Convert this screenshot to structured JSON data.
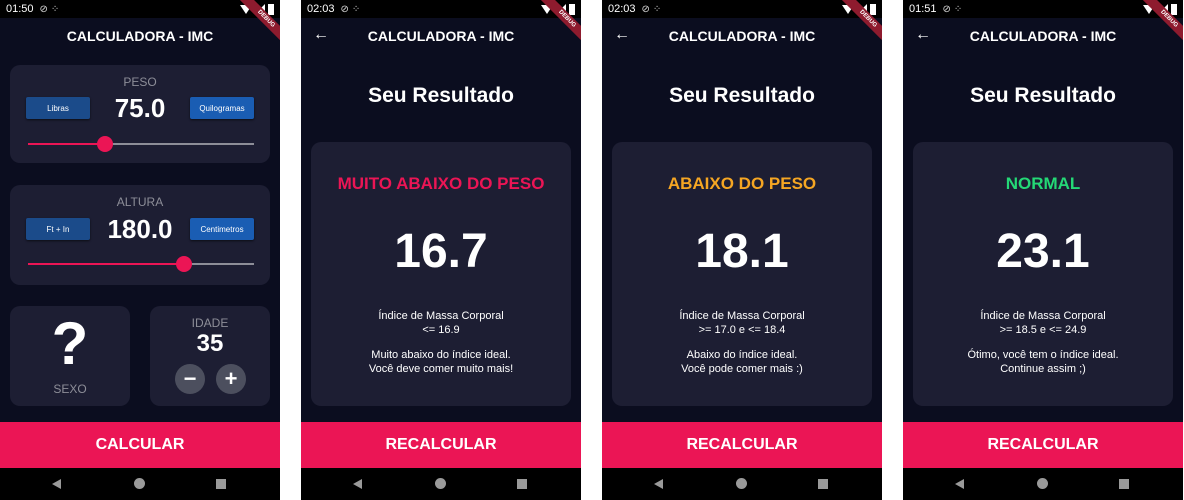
{
  "colors": {
    "accent": "#eb1555",
    "bg": "#0b0d1f",
    "card": "#1d1e33",
    "blue": "#1b4b8a"
  },
  "screens": [
    {
      "status": {
        "time": "01:50"
      },
      "appbar_title": "CALCULADORA - IMC",
      "debug_label": "DEBUG",
      "peso": {
        "label": "PESO",
        "value": "75.0",
        "unit_left": "Libras",
        "unit_right": "Quilogramas",
        "slider_fraction": 0.34
      },
      "altura": {
        "label": "ALTURA",
        "value": "180.0",
        "unit_left": "Ft + In",
        "unit_right": "Centimetros",
        "slider_fraction": 0.69
      },
      "sexo": {
        "label": "SEXO",
        "icon": "?"
      },
      "idade": {
        "label": "IDADE",
        "value": "35",
        "minus": "−",
        "plus": "+"
      },
      "button": "CALCULAR"
    },
    {
      "status": {
        "time": "02:03"
      },
      "appbar_title": "CALCULADORA - IMC",
      "debug_label": "DEBUG",
      "title": "Seu Resultado",
      "status_text": "MUITO ABAIXO DO PESO",
      "status_color": "#eb1555",
      "value": "16.7",
      "line1": "Índice de Massa Corporal",
      "line2": "<= 16.9",
      "line3": "Muito abaixo do índice ideal.",
      "line4": "Você deve comer muito mais!",
      "button": "RECALCULAR"
    },
    {
      "status": {
        "time": "02:03"
      },
      "appbar_title": "CALCULADORA - IMC",
      "debug_label": "DEBUG",
      "title": "Seu Resultado",
      "status_text": "ABAIXO DO PESO",
      "status_color": "#f5a623",
      "value": "18.1",
      "line1": "Índice de Massa Corporal",
      "line2": ">= 17.0 e <= 18.4",
      "line3": "Abaixo do índice ideal.",
      "line4": "Você pode comer mais :)",
      "button": "RECALCULAR"
    },
    {
      "status": {
        "time": "01:51"
      },
      "appbar_title": "CALCULADORA - IMC",
      "debug_label": "DEBUG",
      "title": "Seu Resultado",
      "status_text": "NORMAL",
      "status_color": "#24d876",
      "value": "23.1",
      "line1": "Índice de Massa Corporal",
      "line2": ">= 18.5 e <= 24.9",
      "line3": "Ótimo, você tem o índice ideal.",
      "line4": "Continue assim ;)",
      "button": "RECALCULAR"
    }
  ]
}
